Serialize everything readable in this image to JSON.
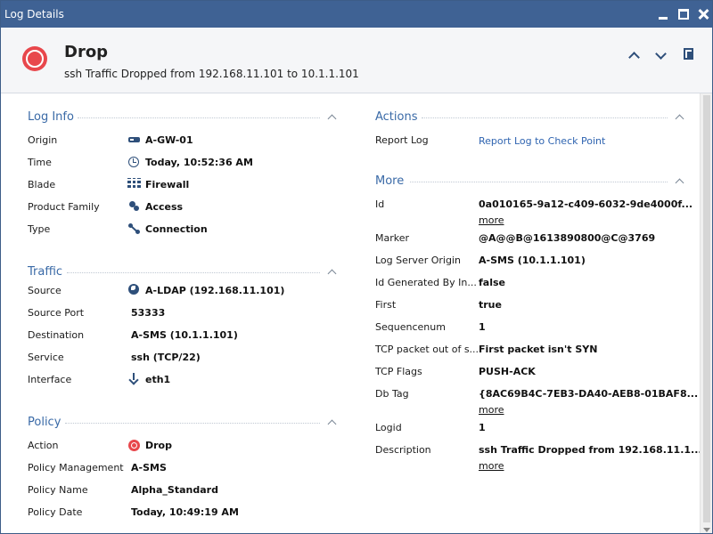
{
  "window": {
    "title": "Log Details"
  },
  "header": {
    "title": "Drop",
    "subtitle": "ssh Traffic Dropped from 192.168.11.101 to 10.1.1.101"
  },
  "log_info": {
    "title": "Log Info",
    "rows": [
      {
        "label": "Origin",
        "value": "A-GW-01",
        "icon": "gateway-icon"
      },
      {
        "label": "Time",
        "value": "Today, 10:52:36 AM",
        "icon": "clock-icon"
      },
      {
        "label": "Blade",
        "value": "Firewall",
        "icon": "firewall-icon"
      },
      {
        "label": "Product Family",
        "value": "Access",
        "icon": "access-icon"
      },
      {
        "label": "Type",
        "value": "Connection",
        "icon": "connection-icon"
      }
    ]
  },
  "traffic": {
    "title": "Traffic",
    "rows": [
      {
        "label": "Source",
        "value": "A-LDAP (192.168.11.101)",
        "icon": "globe-icon"
      },
      {
        "label": "Source Port",
        "value": "53333"
      },
      {
        "label": "Destination",
        "value": "A-SMS (10.1.1.101)"
      },
      {
        "label": "Service",
        "value": "ssh (TCP/22)"
      },
      {
        "label": "Interface",
        "value": "eth1",
        "icon": "inbound-arrow-icon"
      }
    ]
  },
  "policy": {
    "title": "Policy",
    "rows": [
      {
        "label": "Action",
        "value": "Drop",
        "icon": "drop-icon"
      },
      {
        "label": "Policy Management",
        "value": "A-SMS"
      },
      {
        "label": "Policy Name",
        "value": "Alpha_Standard"
      },
      {
        "label": "Policy Date",
        "value": "Today, 10:49:19 AM"
      }
    ]
  },
  "actions": {
    "title": "Actions",
    "rows": [
      {
        "label": "Report Log",
        "value": "Report Log to Check Point"
      }
    ]
  },
  "more": {
    "title": "More",
    "more_link": "more",
    "rows": [
      {
        "label": "Id",
        "value": "0a010165-9a12-c409-6032-9de4000f..."
      },
      {
        "label": "Marker",
        "value": "@A@@B@1613890800@C@3769"
      },
      {
        "label": "Log Server Origin",
        "value": "A-SMS (10.1.1.101)"
      },
      {
        "label": "Id Generated By In...",
        "value": "false"
      },
      {
        "label": "First",
        "value": "true"
      },
      {
        "label": "Sequencenum",
        "value": "1"
      },
      {
        "label": "TCP packet out of s...",
        "value": "First packet isn't SYN"
      },
      {
        "label": "TCP Flags",
        "value": "PUSH-ACK"
      },
      {
        "label": "Db Tag",
        "value": "{8AC69B4C-7EB3-DA40-AEB8-01BAF8..."
      },
      {
        "label": "Logid",
        "value": "1"
      },
      {
        "label": "Description",
        "value": "ssh Traffic Dropped from 192.168.11.1..."
      }
    ]
  },
  "colors": {
    "titlebar": "#3f6294",
    "section_title": "#3a6aa7",
    "link": "#2f64b0",
    "drop": "#e8474c"
  }
}
